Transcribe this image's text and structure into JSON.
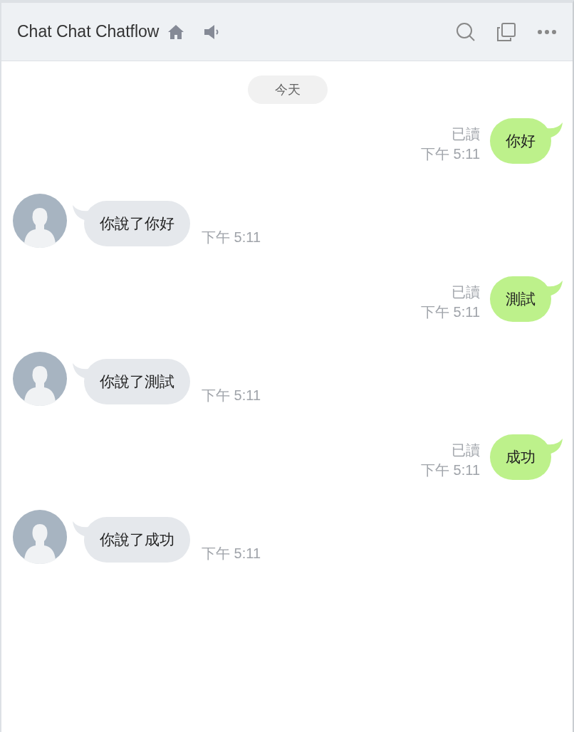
{
  "header": {
    "title": "Chat Chat Chatflow"
  },
  "date_divider": "今天",
  "messages": [
    {
      "kind": "sent",
      "text": "你好",
      "read": "已讀",
      "time": "下午 5:11"
    },
    {
      "kind": "received",
      "text": "你說了你好",
      "time": "下午 5:11"
    },
    {
      "kind": "sent",
      "text": "測試",
      "read": "已讀",
      "time": "下午 5:11"
    },
    {
      "kind": "received",
      "text": "你說了測試",
      "time": "下午 5:11"
    },
    {
      "kind": "sent",
      "text": "成功",
      "read": "已讀",
      "time": "下午 5:11"
    },
    {
      "kind": "received",
      "text": "你說了成功",
      "time": "下午 5:11"
    }
  ]
}
